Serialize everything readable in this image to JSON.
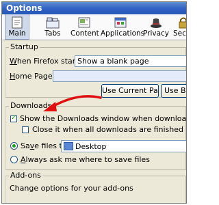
{
  "window": {
    "title": "Options"
  },
  "toolbar": {
    "items": [
      {
        "label": "Main",
        "icon": "main-icon",
        "selected": true
      },
      {
        "label": "Tabs",
        "icon": "tabs-icon"
      },
      {
        "label": "Content",
        "icon": "content-icon"
      },
      {
        "label": "Applications",
        "icon": "applications-icon"
      },
      {
        "label": "Privacy",
        "icon": "privacy-icon"
      },
      {
        "label": "Secu",
        "icon": "security-icon"
      }
    ]
  },
  "startup": {
    "legend": "Startup",
    "when_label": "When Firefox starts:",
    "when_value": "Show a blank page",
    "home_label": "Home Page:",
    "home_value": "",
    "use_current_page": "Use Current Page",
    "use_bookmark": "Use Book"
  },
  "downloads": {
    "legend": "Downloads",
    "show_window": "Show the Downloads window when downloading a file",
    "close_it": "Close it when all downloads are finished",
    "save_files_to": "Save files to",
    "folder_value": "Desktop",
    "always_ask": "Always ask me where to save files"
  },
  "addons": {
    "legend": "Add-ons",
    "description": "Change options for your add-ons"
  },
  "colors": {
    "arrow": "#e01010",
    "titlebar": "#2f62c4",
    "selected_tab": "#cfd9ea"
  }
}
